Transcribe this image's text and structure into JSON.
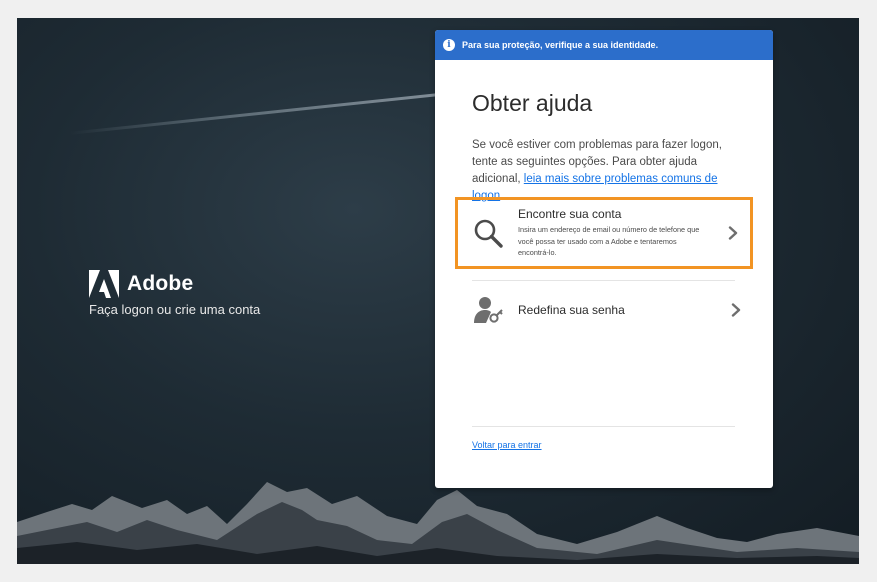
{
  "brand": {
    "name": "Adobe",
    "subtitle": "Faça logon ou crie uma conta"
  },
  "banner": {
    "icon": "info-icon",
    "text": "Para sua proteção, verifique a sua identidade."
  },
  "help": {
    "title": "Obter ajuda",
    "intro_text": "Se você estiver com problemas para fazer logon, tente as seguintes opções. Para obter ajuda adicional, ",
    "intro_link": "leia mais sobre problemas comuns de logon",
    "intro_end": "."
  },
  "options": [
    {
      "icon": "search-icon",
      "title": "Encontre sua conta",
      "description": "Insira um endereço de email ou número de telefone que você possa ter usado com a Adobe e tentaremos encontrá-lo.",
      "highlighted": true
    },
    {
      "icon": "user-key-icon",
      "title": "Redefina sua senha",
      "description": "",
      "highlighted": false
    }
  ],
  "footer": {
    "back_link": "Voltar para entrar"
  },
  "colors": {
    "banner": "#2c6ecb",
    "link": "#1473e6",
    "highlight_border": "#f29423"
  }
}
